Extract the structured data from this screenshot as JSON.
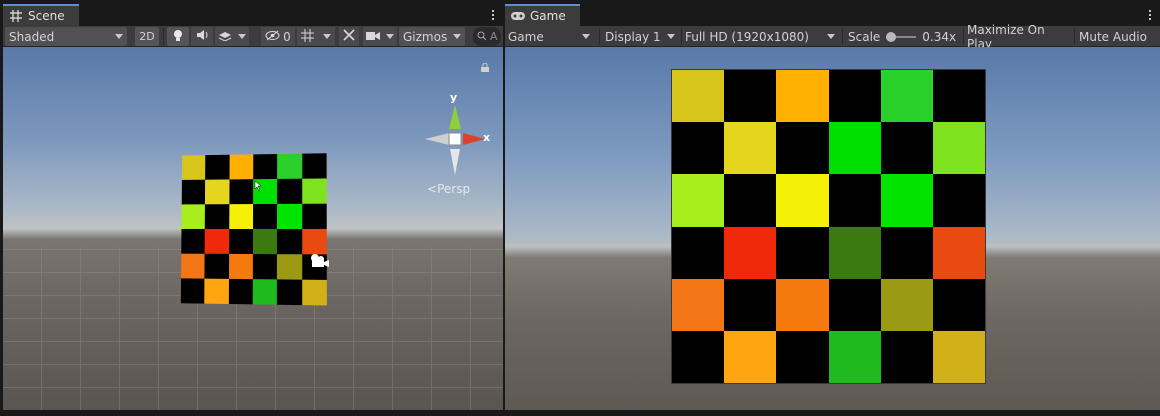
{
  "scene": {
    "tab_label": "Scene",
    "shading_mode": "Shaded",
    "mode_2d": "2D",
    "hidden_count": "0",
    "gizmos_label": "Gizmos",
    "search_placeholder": "A",
    "persp_label": "Persp",
    "axis_x": "x",
    "axis_y": "y"
  },
  "game": {
    "tab_label": "Game",
    "view_mode": "Game",
    "display": "Display 1",
    "resolution": "Full HD (1920x1080)",
    "scale_label": "Scale",
    "scale_value": "0.34x",
    "maximize_label": "Maximize On Play",
    "mute_label": "Mute Audio"
  },
  "checkerboard": {
    "cells": [
      [
        "#d7c51c",
        "#000000",
        "#ffb000",
        "#000000",
        "#2ad12a",
        "#000000"
      ],
      [
        "#000000",
        "#e3d61d",
        "#000000",
        "#00e000",
        "#000000",
        "#7ee21f"
      ],
      [
        "#a8ee1c",
        "#000000",
        "#f5f008",
        "#000000",
        "#00e400",
        "#000000"
      ],
      [
        "#000000",
        "#f02a08",
        "#000000",
        "#3a7a10",
        "#000000",
        "#e84a10"
      ],
      [
        "#f27615",
        "#000000",
        "#f47a10",
        "#000000",
        "#9a9a14",
        "#000000"
      ],
      [
        "#000000",
        "#ffa510",
        "#000000",
        "#1eba1e",
        "#000000",
        "#d2b01a"
      ]
    ]
  },
  "colors": {
    "tab_accent": "#5b8fd9",
    "panel_bg": "#282828",
    "toolbar_bg": "#3c3c3c",
    "gizmo_y": "#8fd03a",
    "gizmo_x": "#e0402a"
  }
}
